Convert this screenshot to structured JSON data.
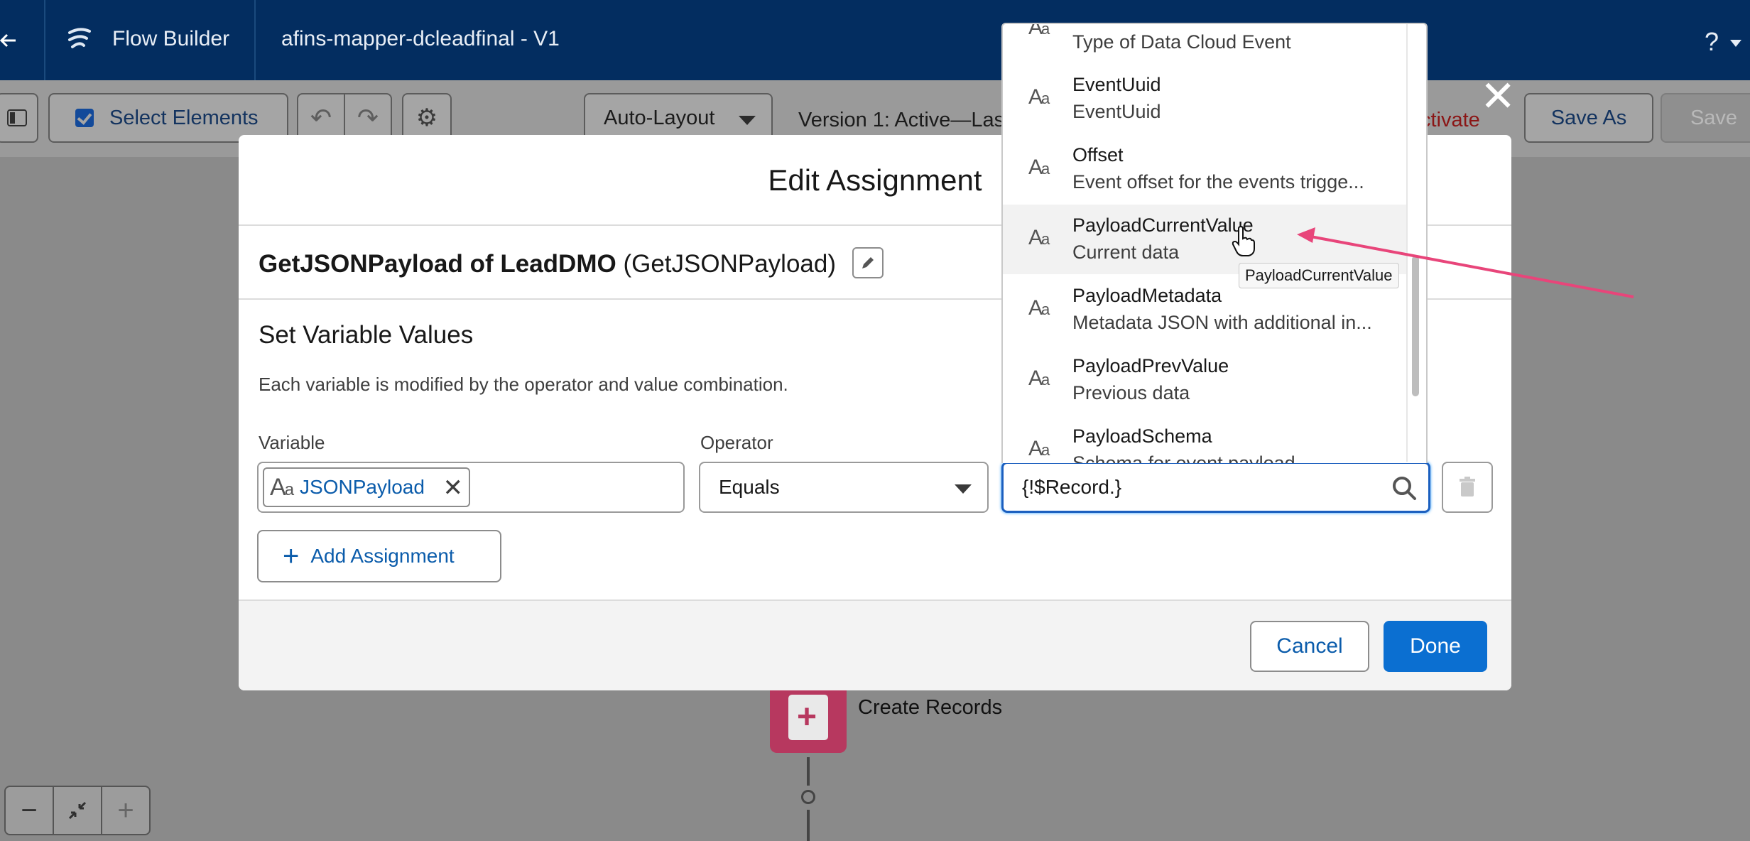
{
  "header": {
    "app_name": "Flow Builder",
    "flow_name": "afins-mapper-dcleadfinal - V1",
    "help": "?"
  },
  "toolbar": {
    "select_elements": "Select Elements",
    "auto_layout": "Auto-Layout",
    "version": "Version 1: Active—Las",
    "activate": "ctivate",
    "save_as": "Save As",
    "save": "Save"
  },
  "canvas": {
    "node_label": "Create Records"
  },
  "modal": {
    "title": "Edit Assignment",
    "element_name": "GetJSONPayload of LeadDMO",
    "element_api_name": "(GetJSONPayload)",
    "section_title": "Set Variable Values",
    "section_desc": "Each variable is modified by the operator and value combination.",
    "variable_label": "Variable",
    "operator_label": "Operator",
    "variable_value": "JSONPayload",
    "operator_value": "Equals",
    "value_input": "{!$Record.}",
    "add_assignment": "Add Assignment",
    "cancel": "Cancel",
    "done": "Done"
  },
  "dropdown": {
    "items": [
      {
        "name": "",
        "desc": "Type of Data Cloud Event"
      },
      {
        "name": "EventUuid",
        "desc": "EventUuid"
      },
      {
        "name": "Offset",
        "desc": "Event offset for the events trigge..."
      },
      {
        "name": "PayloadCurrentValue",
        "desc": "Current data"
      },
      {
        "name": "PayloadMetadata",
        "desc": "Metadata JSON with additional in..."
      },
      {
        "name": "PayloadPrevValue",
        "desc": "Previous data"
      },
      {
        "name": "PayloadSchema",
        "desc": "Schema for event payload"
      }
    ],
    "hovered_item": "PayloadCurrentValue",
    "tooltip": "PayloadCurrentValue"
  },
  "colors": {
    "header_bg": "#032d60",
    "brand_blue": "#0b6fd1",
    "focus_blue": "#1b5fbf",
    "annotation_arrow": "#e8457a"
  }
}
